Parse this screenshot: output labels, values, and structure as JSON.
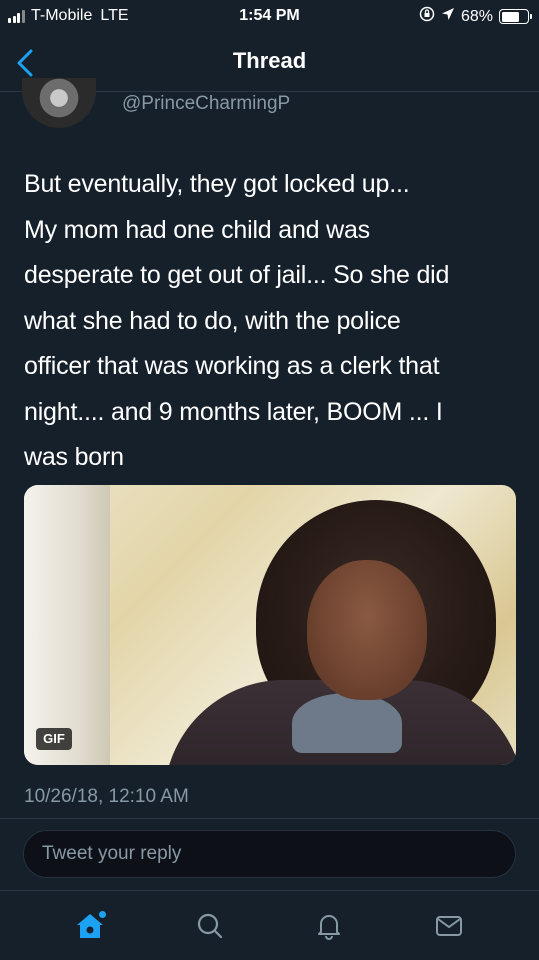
{
  "status_bar": {
    "carrier": "T-Mobile",
    "network": "LTE",
    "time": "1:54 PM",
    "battery_percent": "68%",
    "battery_level": 0.68,
    "icons": [
      "signal-icon",
      "lock-rotation-icon",
      "location-arrow-icon",
      "battery-icon"
    ]
  },
  "nav": {
    "title": "Thread",
    "back_icon": "chevron-left-icon"
  },
  "tweet": {
    "handle": "@PrinceCharmingP",
    "text": "But eventually, they got locked up...\nMy mom had one child and was\ndesperate to get out of jail... So she did\nwhat she had to do, with the police\nofficer that was working as a clerk that\nnight.... and 9 months later, BOOM ... I\nwas born",
    "media_badge": "GIF",
    "timestamp": "10/26/18, 12:10 AM"
  },
  "reply": {
    "placeholder": "Tweet your reply"
  },
  "tab_bar": {
    "items": [
      {
        "name": "home",
        "icon": "home-icon",
        "active": true
      },
      {
        "name": "search",
        "icon": "search-icon",
        "active": false
      },
      {
        "name": "notifications",
        "icon": "bell-icon",
        "active": false
      },
      {
        "name": "messages",
        "icon": "envelope-icon",
        "active": false
      }
    ]
  },
  "colors": {
    "background": "#15202b",
    "accent": "#1da1f2",
    "secondary_text": "#8899a6",
    "divider": "#2a3744"
  }
}
